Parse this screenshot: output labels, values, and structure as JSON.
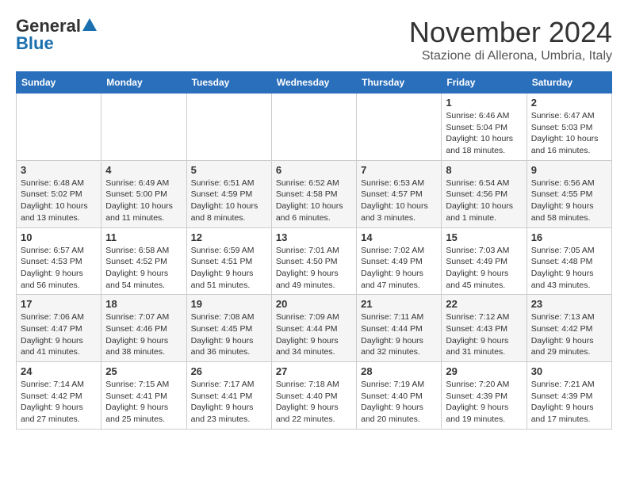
{
  "logo": {
    "general": "General",
    "blue": "Blue"
  },
  "title": {
    "month": "November 2024",
    "location": "Stazione di Allerona, Umbria, Italy"
  },
  "headers": [
    "Sunday",
    "Monday",
    "Tuesday",
    "Wednesday",
    "Thursday",
    "Friday",
    "Saturday"
  ],
  "weeks": [
    [
      {
        "day": "",
        "info": ""
      },
      {
        "day": "",
        "info": ""
      },
      {
        "day": "",
        "info": ""
      },
      {
        "day": "",
        "info": ""
      },
      {
        "day": "",
        "info": ""
      },
      {
        "day": "1",
        "info": "Sunrise: 6:46 AM\nSunset: 5:04 PM\nDaylight: 10 hours and 18 minutes."
      },
      {
        "day": "2",
        "info": "Sunrise: 6:47 AM\nSunset: 5:03 PM\nDaylight: 10 hours and 16 minutes."
      }
    ],
    [
      {
        "day": "3",
        "info": "Sunrise: 6:48 AM\nSunset: 5:02 PM\nDaylight: 10 hours and 13 minutes."
      },
      {
        "day": "4",
        "info": "Sunrise: 6:49 AM\nSunset: 5:00 PM\nDaylight: 10 hours and 11 minutes."
      },
      {
        "day": "5",
        "info": "Sunrise: 6:51 AM\nSunset: 4:59 PM\nDaylight: 10 hours and 8 minutes."
      },
      {
        "day": "6",
        "info": "Sunrise: 6:52 AM\nSunset: 4:58 PM\nDaylight: 10 hours and 6 minutes."
      },
      {
        "day": "7",
        "info": "Sunrise: 6:53 AM\nSunset: 4:57 PM\nDaylight: 10 hours and 3 minutes."
      },
      {
        "day": "8",
        "info": "Sunrise: 6:54 AM\nSunset: 4:56 PM\nDaylight: 10 hours and 1 minute."
      },
      {
        "day": "9",
        "info": "Sunrise: 6:56 AM\nSunset: 4:55 PM\nDaylight: 9 hours and 58 minutes."
      }
    ],
    [
      {
        "day": "10",
        "info": "Sunrise: 6:57 AM\nSunset: 4:53 PM\nDaylight: 9 hours and 56 minutes."
      },
      {
        "day": "11",
        "info": "Sunrise: 6:58 AM\nSunset: 4:52 PM\nDaylight: 9 hours and 54 minutes."
      },
      {
        "day": "12",
        "info": "Sunrise: 6:59 AM\nSunset: 4:51 PM\nDaylight: 9 hours and 51 minutes."
      },
      {
        "day": "13",
        "info": "Sunrise: 7:01 AM\nSunset: 4:50 PM\nDaylight: 9 hours and 49 minutes."
      },
      {
        "day": "14",
        "info": "Sunrise: 7:02 AM\nSunset: 4:49 PM\nDaylight: 9 hours and 47 minutes."
      },
      {
        "day": "15",
        "info": "Sunrise: 7:03 AM\nSunset: 4:49 PM\nDaylight: 9 hours and 45 minutes."
      },
      {
        "day": "16",
        "info": "Sunrise: 7:05 AM\nSunset: 4:48 PM\nDaylight: 9 hours and 43 minutes."
      }
    ],
    [
      {
        "day": "17",
        "info": "Sunrise: 7:06 AM\nSunset: 4:47 PM\nDaylight: 9 hours and 41 minutes."
      },
      {
        "day": "18",
        "info": "Sunrise: 7:07 AM\nSunset: 4:46 PM\nDaylight: 9 hours and 38 minutes."
      },
      {
        "day": "19",
        "info": "Sunrise: 7:08 AM\nSunset: 4:45 PM\nDaylight: 9 hours and 36 minutes."
      },
      {
        "day": "20",
        "info": "Sunrise: 7:09 AM\nSunset: 4:44 PM\nDaylight: 9 hours and 34 minutes."
      },
      {
        "day": "21",
        "info": "Sunrise: 7:11 AM\nSunset: 4:44 PM\nDaylight: 9 hours and 32 minutes."
      },
      {
        "day": "22",
        "info": "Sunrise: 7:12 AM\nSunset: 4:43 PM\nDaylight: 9 hours and 31 minutes."
      },
      {
        "day": "23",
        "info": "Sunrise: 7:13 AM\nSunset: 4:42 PM\nDaylight: 9 hours and 29 minutes."
      }
    ],
    [
      {
        "day": "24",
        "info": "Sunrise: 7:14 AM\nSunset: 4:42 PM\nDaylight: 9 hours and 27 minutes."
      },
      {
        "day": "25",
        "info": "Sunrise: 7:15 AM\nSunset: 4:41 PM\nDaylight: 9 hours and 25 minutes."
      },
      {
        "day": "26",
        "info": "Sunrise: 7:17 AM\nSunset: 4:41 PM\nDaylight: 9 hours and 23 minutes."
      },
      {
        "day": "27",
        "info": "Sunrise: 7:18 AM\nSunset: 4:40 PM\nDaylight: 9 hours and 22 minutes."
      },
      {
        "day": "28",
        "info": "Sunrise: 7:19 AM\nSunset: 4:40 PM\nDaylight: 9 hours and 20 minutes."
      },
      {
        "day": "29",
        "info": "Sunrise: 7:20 AM\nSunset: 4:39 PM\nDaylight: 9 hours and 19 minutes."
      },
      {
        "day": "30",
        "info": "Sunrise: 7:21 AM\nSunset: 4:39 PM\nDaylight: 9 hours and 17 minutes."
      }
    ]
  ]
}
